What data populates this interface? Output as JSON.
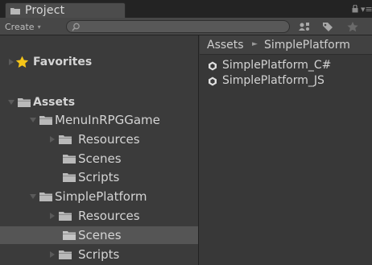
{
  "window": {
    "tab_title": "Project",
    "menu_glyph": "▾≡"
  },
  "toolbar": {
    "create_label": "Create",
    "create_caret": "▾",
    "search_placeholder": ""
  },
  "tree": {
    "favorites": "Favorites",
    "assets": "Assets",
    "menu_game": "MenuInRPGGame",
    "menu_resources": "Resources",
    "menu_scenes": "Scenes",
    "menu_scripts": "Scripts",
    "simple_platform": "SimplePlatform",
    "sp_resources": "Resources",
    "sp_scenes": "Scenes",
    "sp_scripts": "Scripts"
  },
  "breadcrumb": {
    "root": "Assets",
    "separator": "►",
    "current": "SimplePlatform"
  },
  "files": [
    {
      "name": "SimplePlatform_C#",
      "icon": "unity-script-icon"
    },
    {
      "name": "SimplePlatform_JS",
      "icon": "unity-script-icon"
    }
  ],
  "colors": {
    "folder": "#b9b9b9",
    "star": "#f5c518",
    "selected_row": "#555555",
    "panel_bg": "#383838"
  }
}
